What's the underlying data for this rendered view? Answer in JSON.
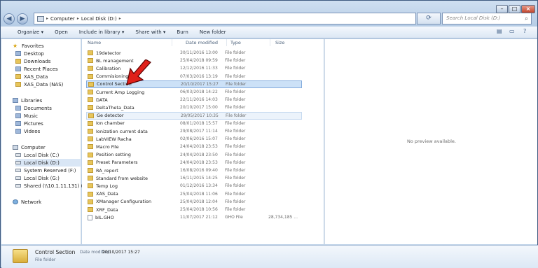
{
  "address": {
    "crumbs": [
      "Computer",
      "Local Disk (D:)"
    ],
    "search_placeholder": "Search Local Disk (D:)"
  },
  "toolbar": {
    "organize": "Organize ▾",
    "open": "Open",
    "include": "Include in library ▾",
    "share": "Share with ▾",
    "burn": "Burn",
    "new_folder": "New folder"
  },
  "nav": {
    "favorites": "Favorites",
    "desktop": "Desktop",
    "downloads": "Downloads",
    "recent": "Recent Places",
    "xas_data": "XAS_Data",
    "xas_nas": "XAS_Data (NAS)",
    "libraries": "Libraries",
    "documents": "Documents",
    "music": "Music",
    "pictures": "Pictures",
    "videos": "Videos",
    "computer": "Computer",
    "disk_c": "Local Disk (C:)",
    "disk_d": "Local Disk (D:)",
    "reserved": "System Reserved (F:)",
    "disk_g": "Local Disk (G:)",
    "shared": "Shared (\\\\10.1.11.131) (Z:)",
    "network": "Network"
  },
  "columns": {
    "name": "Name",
    "date": "Date modified",
    "type": "Type",
    "size": "Size"
  },
  "files": [
    {
      "name": "19detector",
      "date": "30/11/2016 13:00",
      "type": "File folder",
      "size": ""
    },
    {
      "name": "BL management",
      "date": "25/04/2018 09:59",
      "type": "File folder",
      "size": ""
    },
    {
      "name": "Calibration",
      "date": "12/12/2016 11:33",
      "type": "File folder",
      "size": ""
    },
    {
      "name": "Commisioning",
      "date": "07/03/2016 13:19",
      "type": "File folder",
      "size": ""
    },
    {
      "name": "Control Section",
      "date": "20/10/2017 15:27",
      "type": "File folder",
      "size": ""
    },
    {
      "name": "Current Amp Logging",
      "date": "06/03/2018 14:22",
      "type": "File folder",
      "size": ""
    },
    {
      "name": "DATA",
      "date": "22/11/2016 14:03",
      "type": "File folder",
      "size": ""
    },
    {
      "name": "DeltaTheta_Data",
      "date": "20/10/2017 15:00",
      "type": "File folder",
      "size": ""
    },
    {
      "name": "Ge detector",
      "date": "29/05/2017 10:35",
      "type": "File folder",
      "size": ""
    },
    {
      "name": "Ion chamber",
      "date": "08/01/2018 15:57",
      "type": "File folder",
      "size": ""
    },
    {
      "name": "Ionization current data",
      "date": "29/08/2017 11:14",
      "type": "File folder",
      "size": ""
    },
    {
      "name": "LabVIEW Racha",
      "date": "02/06/2016 15:07",
      "type": "File folder",
      "size": ""
    },
    {
      "name": "Macro File",
      "date": "24/04/2018 23:53",
      "type": "File folder",
      "size": ""
    },
    {
      "name": "Position setting",
      "date": "24/04/2018 23:50",
      "type": "File folder",
      "size": ""
    },
    {
      "name": "Preset Parameters",
      "date": "24/04/2018 23:53",
      "type": "File folder",
      "size": ""
    },
    {
      "name": "RA_report",
      "date": "16/08/2016 09:40",
      "type": "File folder",
      "size": ""
    },
    {
      "name": "Standard from website",
      "date": "16/11/2015 14:25",
      "type": "File folder",
      "size": ""
    },
    {
      "name": "Temp Log",
      "date": "01/12/2016 13:34",
      "type": "File folder",
      "size": ""
    },
    {
      "name": "XAS_Data",
      "date": "25/04/2018 11:06",
      "type": "File folder",
      "size": ""
    },
    {
      "name": "XManager Configuration",
      "date": "25/04/2018 12:04",
      "type": "File folder",
      "size": ""
    },
    {
      "name": "XRF_Data",
      "date": "25/04/2018 10:56",
      "type": "File folder",
      "size": ""
    },
    {
      "name": "bIL.GHO",
      "date": "11/07/2017 21:12",
      "type": "GHO File",
      "size": "28,734,185 ..."
    }
  ],
  "preview": {
    "message": "No preview available."
  },
  "details": {
    "name": "Control Section",
    "date_label": "Date modified:",
    "date": "20/10/2017 15:27",
    "type": "File folder"
  },
  "colors": {
    "selection": "#cce1f7",
    "selection_border": "#84acdd",
    "arrow_red": "#e0201a",
    "frame": "#bfd2e8"
  }
}
